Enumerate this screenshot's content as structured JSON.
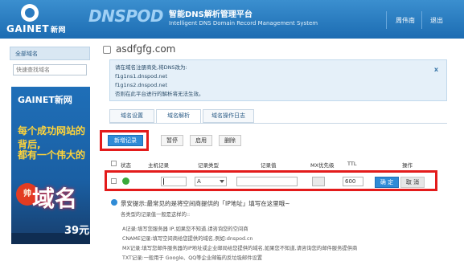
{
  "header": {
    "brand": "GAINET",
    "brand_cn": "新网",
    "product": "DNSPOD",
    "title_cn": "智能DNS解析管理平台",
    "title_en": "Intelligent DNS Domain Record Management System",
    "user": "周伟南",
    "logout": "退出"
  },
  "sidebar": {
    "title": "全部域名",
    "search_placeholder": "快速查找域名",
    "ad": {
      "logo": "GAINET新网",
      "line1": "每个成功网站的背后,",
      "line2": "都有一个伟大的",
      "badge": "帅",
      "big": "域名",
      "price": "39元"
    }
  },
  "main": {
    "domain": "asdfgfg.com",
    "notice": [
      "请在域名注册商处,将DNS改为:",
      "f1g1ns1.dnspod.net",
      "f1g1ns2.dnspod.net",
      "否则在此平台进行的解析将无法生效。"
    ],
    "notice_close": "x",
    "tabs": [
      "域名设置",
      "域名解析",
      "域名操作日志"
    ],
    "actions": {
      "add": "新增记录",
      "pause": "暂停",
      "enable": "启用",
      "delete": "删除"
    },
    "columns": [
      "状态",
      "主机记录",
      "记录类型",
      "记录值",
      "MX优先级",
      "TTL",
      "操作"
    ],
    "new_row": {
      "type": "A",
      "ttl": "600",
      "confirm": "确 定",
      "cancel": "取 消"
    },
    "tips": {
      "head": "景安提示:最常见的是将空间商提供的「IP地址」填写在这里哦~",
      "subtitle": "各类型的记录值一般是这样的::",
      "lines": [
        "A记录:填写您服务器 IP,如果您不知道,请咨询您的空间商",
        "CNAME记录:填写空间商给您提供的域名,例如:dnspod.cn",
        "MX记录:填写您邮件服务器的IP地址或企业邮局给您提供的域名,如果您不知道,请咨询您的邮件服务提供商",
        "TXT记录:一般用于 Google、QQ等企业邮箱的反垃圾邮件设置"
      ]
    }
  }
}
